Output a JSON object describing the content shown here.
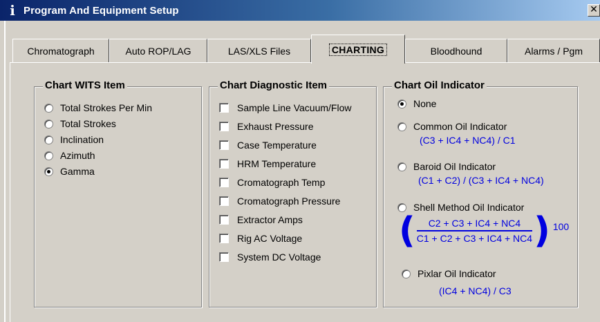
{
  "window": {
    "title": "Program And Equipment Setup",
    "icon": "info-icon",
    "close_label": "✕"
  },
  "tabs": [
    {
      "label": "Chromatograph",
      "active": false
    },
    {
      "label": "Auto ROP/LAG",
      "active": false
    },
    {
      "label": "LAS/XLS Files",
      "active": false
    },
    {
      "label": "CHARTING",
      "active": true
    },
    {
      "label": "Bloodhound",
      "active": false
    },
    {
      "label": "Alarms / Pgm",
      "active": false
    }
  ],
  "wits": {
    "title": "Chart WITS Item",
    "items": [
      {
        "label": "Total Strokes Per Min",
        "checked": false
      },
      {
        "label": "Total Strokes",
        "checked": false
      },
      {
        "label": "Inclination",
        "checked": false
      },
      {
        "label": "Azimuth",
        "checked": false
      },
      {
        "label": "Gamma",
        "checked": true
      }
    ]
  },
  "diagnostic": {
    "title": "Chart Diagnostic Item",
    "items": [
      {
        "label": "Sample Line Vacuum/Flow",
        "checked": false
      },
      {
        "label": "Exhaust Pressure",
        "checked": false
      },
      {
        "label": "Case Temperature",
        "checked": false
      },
      {
        "label": "HRM Temperature",
        "checked": false
      },
      {
        "label": "Cromatograph Temp",
        "checked": false
      },
      {
        "label": "Cromatograph Pressure",
        "checked": false
      },
      {
        "label": "Extractor Amps",
        "checked": false
      },
      {
        "label": "Rig AC Voltage",
        "checked": false
      },
      {
        "label": "System DC Voltage",
        "checked": false
      }
    ]
  },
  "oil": {
    "title": "Chart Oil Indicator",
    "none_label": "None",
    "common": {
      "label": "Common Oil Indicator",
      "formula": "(C3 + IC4 + NC4) / C1"
    },
    "baroid": {
      "label": "Baroid Oil Indicator",
      "formula": "(C1 + C2) / (C3 + IC4 + NC4)"
    },
    "shell": {
      "label": "Shell Method Oil Indicator",
      "numerator": "C2 + C3 + IC4 + NC4",
      "denominator": "C1 + C2 + C3 + IC4 + NC4",
      "multiplier": "100"
    },
    "pixlar": {
      "label": "Pixlar Oil Indicator",
      "formula": "(IC4 + NC4) / C3"
    },
    "selected": "None",
    "formula_color": "#0000e0"
  }
}
